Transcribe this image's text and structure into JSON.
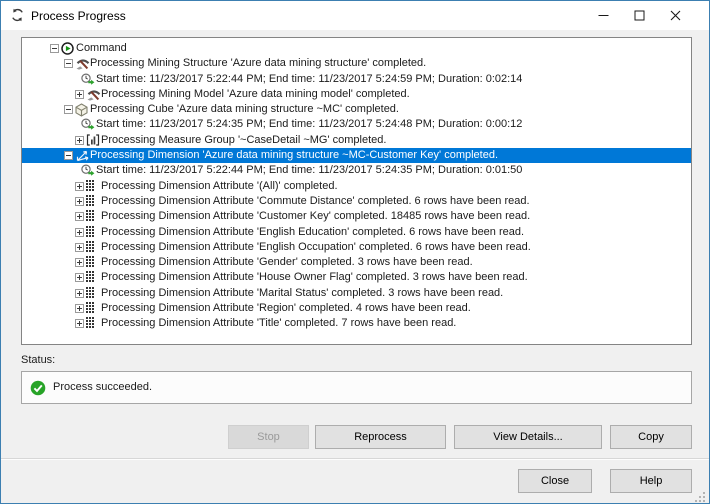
{
  "window": {
    "title": "Process Progress",
    "titlebar_icon": "process-arrows-icon",
    "controls": [
      "minimize-button",
      "maximize-button",
      "close-button"
    ]
  },
  "tree": {
    "rows": [
      {
        "level": 0,
        "expander": "minus",
        "icon": "play-circle-icon",
        "text": "Command",
        "selected": false
      },
      {
        "level": 1,
        "expander": "minus",
        "icon": "mining-structure-icon",
        "text": "Processing Mining Structure 'Azure data mining structure' completed.",
        "selected": false
      },
      {
        "level": 2,
        "expander": null,
        "icon": "clock-icon",
        "text": "Start time: 11/23/2017 5:22:44 PM; End time: 11/23/2017 5:24:59 PM; Duration: 0:02:14",
        "selected": false
      },
      {
        "level": 2,
        "expander": "plus",
        "icon": "mining-model-icon",
        "text": "Processing Mining Model 'Azure data mining model' completed.",
        "selected": false
      },
      {
        "level": 1,
        "expander": "minus",
        "icon": "cube-icon",
        "text": "Processing Cube 'Azure data mining structure ~MC' completed.",
        "selected": false
      },
      {
        "level": 2,
        "expander": null,
        "icon": "clock-icon",
        "text": "Start time: 11/23/2017 5:24:35 PM; End time: 11/23/2017 5:24:48 PM; Duration: 0:00:12",
        "selected": false
      },
      {
        "level": 2,
        "expander": "plus",
        "icon": "measure-group-icon",
        "text": "Processing Measure Group '~CaseDetail ~MG' completed.",
        "selected": false
      },
      {
        "level": 1,
        "expander": "minus",
        "icon": "dimension-icon",
        "text": "Processing Dimension 'Azure data mining structure ~MC-Customer Key' completed.",
        "selected": true
      },
      {
        "level": 2,
        "expander": null,
        "icon": "clock-icon",
        "text": "Start time: 11/23/2017 5:22:44 PM; End time: 11/23/2017 5:24:35 PM; Duration: 0:01:50",
        "selected": false
      },
      {
        "level": 2,
        "expander": "plus",
        "icon": "attribute-grid-icon",
        "text": "Processing Dimension Attribute '(All)' completed.",
        "selected": false
      },
      {
        "level": 2,
        "expander": "plus",
        "icon": "attribute-grid-icon",
        "text": "Processing Dimension Attribute 'Commute Distance' completed. 6 rows have been read.",
        "selected": false
      },
      {
        "level": 2,
        "expander": "plus",
        "icon": "attribute-grid-icon",
        "text": "Processing Dimension Attribute 'Customer Key' completed. 18485 rows have been read.",
        "selected": false
      },
      {
        "level": 2,
        "expander": "plus",
        "icon": "attribute-grid-icon",
        "text": "Processing Dimension Attribute 'English Education' completed. 6 rows have been read.",
        "selected": false
      },
      {
        "level": 2,
        "expander": "plus",
        "icon": "attribute-grid-icon",
        "text": "Processing Dimension Attribute 'English Occupation' completed. 6 rows have been read.",
        "selected": false
      },
      {
        "level": 2,
        "expander": "plus",
        "icon": "attribute-grid-icon",
        "text": "Processing Dimension Attribute 'Gender' completed. 3 rows have been read.",
        "selected": false
      },
      {
        "level": 2,
        "expander": "plus",
        "icon": "attribute-grid-icon",
        "text": "Processing Dimension Attribute 'House Owner Flag' completed. 3 rows have been read.",
        "selected": false
      },
      {
        "level": 2,
        "expander": "plus",
        "icon": "attribute-grid-icon",
        "text": "Processing Dimension Attribute 'Marital Status' completed. 3 rows have been read.",
        "selected": false
      },
      {
        "level": 2,
        "expander": "plus",
        "icon": "attribute-grid-icon",
        "text": "Processing Dimension Attribute 'Region' completed. 4 rows have been read.",
        "selected": false
      },
      {
        "level": 2,
        "expander": "plus",
        "icon": "attribute-grid-icon",
        "text": "Processing Dimension Attribute 'Title' completed. 7 rows have been read.",
        "selected": false
      }
    ]
  },
  "status": {
    "label": "Status:",
    "icon": "check-circle-icon",
    "message": "Process succeeded."
  },
  "buttons": {
    "stop": {
      "label": "Stop",
      "enabled": false
    },
    "reprocess": {
      "label": "Reprocess",
      "enabled": true
    },
    "view_details": {
      "label": "View Details...",
      "enabled": true
    },
    "copy": {
      "label": "Copy",
      "enabled": true
    },
    "close": {
      "label": "Close",
      "enabled": true
    },
    "help": {
      "label": "Help",
      "enabled": true
    }
  },
  "colors": {
    "selection_blue": "#0078d7",
    "success_green": "#27a327",
    "titlebar_bg": "#ffffff",
    "dialog_bg": "#f0f0f0",
    "window_border": "#3c7fb1"
  }
}
